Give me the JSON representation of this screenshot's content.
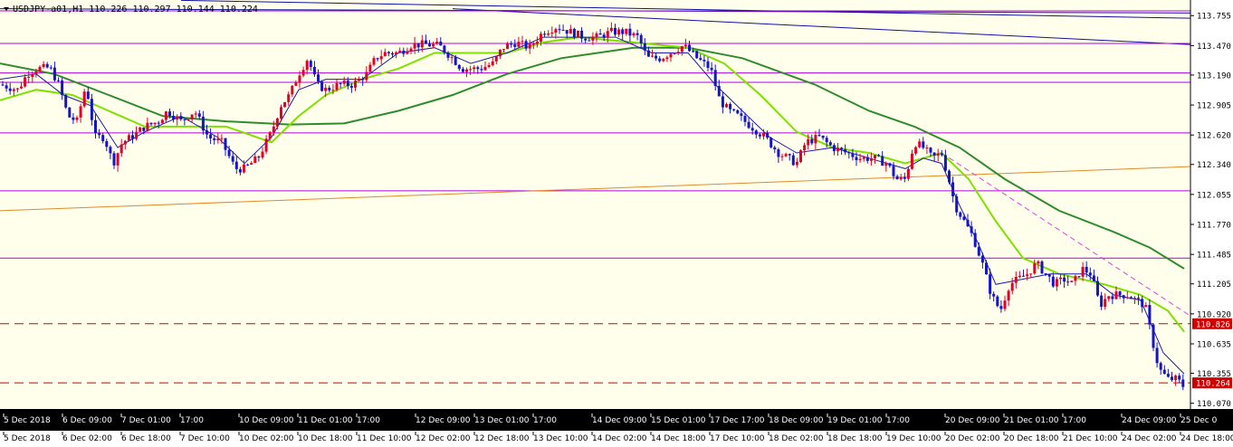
{
  "header": {
    "symbol_label": "USDJPY-a01,H1  110.226 110.297 110.144 110.224"
  },
  "colors": {
    "background": "#FFFFEB",
    "panel": "#FFFFFF",
    "axis_bar": "#000000",
    "bull_candle": "#E0002A",
    "bear_candle": "#1414C8",
    "ma_fast": "#1B1BA8",
    "ma_mid": "#7FE000",
    "ma_slow": "#2E8B2E",
    "level_line": "#B000E0",
    "trend_line": "#E08A2A",
    "channel_line": "#1010A0",
    "dashed_level": "#D00000",
    "diag_dash": "#E040E0",
    "tag_bg": "#D00000",
    "tag_text": "#FFFFFF"
  },
  "chart_data": {
    "type": "candlestick",
    "title": "USDJPY-a01,H1",
    "ohlc_latest": {
      "open": 110.226,
      "high": 110.297,
      "low": 110.144,
      "close": 110.224
    },
    "y_axis": {
      "range": [
        110.07,
        113.76
      ],
      "ticks": [
        "113.755",
        "113.470",
        "113.190",
        "112.905",
        "112.620",
        "112.340",
        "112.055",
        "111.770",
        "111.485",
        "111.205",
        "110.920",
        "110.635",
        "110.355",
        "110.070"
      ]
    },
    "x_axis_top": [
      "5 Dec 2018",
      "6 Dec 09:00",
      "7 Dec 01:00",
      "17:00",
      "10 Dec 09:00",
      "11 Dec 01:00",
      "17:00",
      "12 Dec 09:00",
      "13 Dec 01:00",
      "17:00",
      "14 Dec 09:00",
      "15 Dec 01:00",
      "17 Dec 17:00",
      "18 Dec 09:00",
      "19 Dec 01:00",
      "17:00",
      "20 Dec 09:00",
      "21 Dec 01:00",
      "17:00",
      "24 Dec 09:00",
      "25 Dec 0"
    ],
    "x_axis_bottom": [
      "5 Dec 2018",
      "6 Dec 02:00",
      "6 Dec 18:00",
      "7 Dec 10:00",
      "10 Dec 02:00",
      "10 Dec 18:00",
      "11 Dec 10:00",
      "12 Dec 02:00",
      "12 Dec 18:00",
      "13 Dec 10:00",
      "14 Dec 02:00",
      "14 Dec 18:00",
      "17 Dec 10:00",
      "18 Dec 02:00",
      "18 Dec 18:00",
      "19 Dec 10:00",
      "20 Dec 02:00",
      "20 Dec 18:00",
      "21 Dec 10:00",
      "24 Dec 02:00",
      "24 Dec 18:00"
    ],
    "price_tags": [
      {
        "label": "110.826",
        "value": 110.826
      },
      {
        "label": "110.264",
        "value": 110.264
      }
    ],
    "horizontal_levels": [
      113.8,
      113.49,
      113.21,
      113.12,
      112.64,
      112.09,
      111.45
    ],
    "dashed_levels": [
      110.826,
      110.264
    ],
    "close_path": [
      [
        0,
        113.1
      ],
      [
        20,
        113.05
      ],
      [
        30,
        113.2
      ],
      [
        40,
        113.25
      ],
      [
        55,
        113.26
      ],
      [
        65,
        113.1
      ],
      [
        75,
        112.8
      ],
      [
        85,
        112.75
      ],
      [
        95,
        113.1
      ],
      [
        105,
        112.6
      ],
      [
        115,
        112.6
      ],
      [
        125,
        112.35
      ],
      [
        135,
        112.55
      ],
      [
        145,
        112.6
      ],
      [
        160,
        112.7
      ],
      [
        175,
        112.75
      ],
      [
        185,
        112.85
      ],
      [
        200,
        112.75
      ],
      [
        215,
        112.85
      ],
      [
        230,
        112.6
      ],
      [
        245,
        112.55
      ],
      [
        260,
        112.3
      ],
      [
        270,
        112.3
      ],
      [
        285,
        112.4
      ],
      [
        300,
        112.65
      ],
      [
        310,
        112.9
      ],
      [
        320,
        113.0
      ],
      [
        330,
        113.2
      ],
      [
        340,
        113.35
      ],
      [
        350,
        113.1
      ],
      [
        360,
        113.05
      ],
      [
        375,
        113.1
      ],
      [
        390,
        113.1
      ],
      [
        405,
        113.2
      ],
      [
        415,
        113.35
      ],
      [
        425,
        113.4
      ],
      [
        440,
        113.4
      ],
      [
        455,
        113.48
      ],
      [
        470,
        113.48
      ],
      [
        485,
        113.47
      ],
      [
        500,
        113.35
      ],
      [
        510,
        113.25
      ],
      [
        520,
        113.25
      ],
      [
        530,
        113.25
      ],
      [
        545,
        113.3
      ],
      [
        555,
        113.45
      ],
      [
        570,
        113.5
      ],
      [
        585,
        113.45
      ],
      [
        600,
        113.6
      ],
      [
        615,
        113.65
      ],
      [
        630,
        113.6
      ],
      [
        645,
        113.55
      ],
      [
        660,
        113.55
      ],
      [
        675,
        113.6
      ],
      [
        690,
        113.6
      ],
      [
        705,
        113.55
      ],
      [
        715,
        113.35
      ],
      [
        730,
        113.35
      ],
      [
        740,
        113.4
      ],
      [
        755,
        113.47
      ],
      [
        770,
        113.35
      ],
      [
        785,
        113.25
      ],
      [
        795,
        112.95
      ],
      [
        805,
        112.85
      ],
      [
        815,
        112.8
      ],
      [
        830,
        112.7
      ],
      [
        845,
        112.6
      ],
      [
        860,
        112.45
      ],
      [
        870,
        112.4
      ],
      [
        880,
        112.35
      ],
      [
        890,
        112.55
      ],
      [
        905,
        112.6
      ],
      [
        920,
        112.5
      ],
      [
        935,
        112.45
      ],
      [
        950,
        112.4
      ],
      [
        965,
        112.4
      ],
      [
        980,
        112.35
      ],
      [
        990,
        112.2
      ],
      [
        1000,
        112.2
      ],
      [
        1010,
        112.55
      ],
      [
        1020,
        112.5
      ],
      [
        1030,
        112.4
      ],
      [
        1040,
        112.45
      ],
      [
        1048,
        112.2
      ],
      [
        1055,
        111.95
      ],
      [
        1065,
        111.8
      ],
      [
        1075,
        111.65
      ],
      [
        1085,
        111.4
      ],
      [
        1095,
        111.1
      ],
      [
        1105,
        110.95
      ],
      [
        1115,
        111.2
      ],
      [
        1125,
        111.25
      ],
      [
        1135,
        111.3
      ],
      [
        1145,
        111.4
      ],
      [
        1155,
        111.3
      ],
      [
        1165,
        111.2
      ],
      [
        1175,
        111.25
      ],
      [
        1185,
        111.2
      ],
      [
        1195,
        111.35
      ],
      [
        1205,
        111.3
      ],
      [
        1215,
        111.0
      ],
      [
        1225,
        111.1
      ],
      [
        1235,
        111.1
      ],
      [
        1245,
        111.1
      ],
      [
        1255,
        111.05
      ],
      [
        1265,
        111.0
      ],
      [
        1272,
        110.7
      ],
      [
        1280,
        110.4
      ],
      [
        1290,
        110.3
      ],
      [
        1300,
        110.3
      ],
      [
        1308,
        110.224
      ]
    ],
    "ma_fast_path": [
      [
        0,
        113.15
      ],
      [
        40,
        113.2
      ],
      [
        70,
        113.0
      ],
      [
        100,
        112.9
      ],
      [
        130,
        112.5
      ],
      [
        160,
        112.65
      ],
      [
        200,
        112.8
      ],
      [
        240,
        112.6
      ],
      [
        270,
        112.35
      ],
      [
        300,
        112.6
      ],
      [
        330,
        113.05
      ],
      [
        360,
        113.15
      ],
      [
        400,
        113.15
      ],
      [
        440,
        113.4
      ],
      [
        480,
        113.45
      ],
      [
        520,
        113.3
      ],
      [
        560,
        113.4
      ],
      [
        600,
        113.55
      ],
      [
        640,
        113.55
      ],
      [
        680,
        113.55
      ],
      [
        720,
        113.4
      ],
      [
        760,
        113.4
      ],
      [
        790,
        113.1
      ],
      [
        820,
        112.85
      ],
      [
        850,
        112.6
      ],
      [
        880,
        112.45
      ],
      [
        920,
        112.5
      ],
      [
        960,
        112.4
      ],
      [
        1000,
        112.3
      ],
      [
        1020,
        112.4
      ],
      [
        1040,
        112.35
      ],
      [
        1060,
        111.95
      ],
      [
        1080,
        111.6
      ],
      [
        1100,
        111.2
      ],
      [
        1130,
        111.25
      ],
      [
        1160,
        111.3
      ],
      [
        1200,
        111.3
      ],
      [
        1230,
        111.1
      ],
      [
        1260,
        111.05
      ],
      [
        1285,
        110.55
      ],
      [
        1308,
        110.35
      ]
    ],
    "ma_mid_path": [
      [
        0,
        112.95
      ],
      [
        40,
        113.05
      ],
      [
        80,
        113.0
      ],
      [
        120,
        112.85
      ],
      [
        160,
        112.7
      ],
      [
        200,
        112.7
      ],
      [
        250,
        112.7
      ],
      [
        300,
        112.55
      ],
      [
        330,
        112.8
      ],
      [
        360,
        113.0
      ],
      [
        400,
        113.15
      ],
      [
        440,
        113.25
      ],
      [
        480,
        113.4
      ],
      [
        520,
        113.4
      ],
      [
        560,
        113.4
      ],
      [
        600,
        113.5
      ],
      [
        640,
        113.55
      ],
      [
        700,
        113.5
      ],
      [
        760,
        113.45
      ],
      [
        800,
        113.3
      ],
      [
        840,
        113.0
      ],
      [
        880,
        112.65
      ],
      [
        920,
        112.5
      ],
      [
        960,
        112.45
      ],
      [
        1000,
        112.35
      ],
      [
        1040,
        112.45
      ],
      [
        1070,
        112.2
      ],
      [
        1100,
        111.8
      ],
      [
        1130,
        111.45
      ],
      [
        1170,
        111.3
      ],
      [
        1220,
        111.2
      ],
      [
        1260,
        111.1
      ],
      [
        1290,
        110.95
      ],
      [
        1308,
        110.75
      ]
    ],
    "ma_slow_path": [
      [
        0,
        113.3
      ],
      [
        60,
        113.2
      ],
      [
        120,
        113.0
      ],
      [
        180,
        112.8
      ],
      [
        250,
        112.75
      ],
      [
        320,
        112.72
      ],
      [
        380,
        112.73
      ],
      [
        440,
        112.85
      ],
      [
        500,
        113.0
      ],
      [
        560,
        113.2
      ],
      [
        620,
        113.35
      ],
      [
        700,
        113.45
      ],
      [
        760,
        113.45
      ],
      [
        820,
        113.35
      ],
      [
        900,
        113.1
      ],
      [
        960,
        112.85
      ],
      [
        1010,
        112.7
      ],
      [
        1060,
        112.5
      ],
      [
        1110,
        112.2
      ],
      [
        1170,
        111.9
      ],
      [
        1230,
        111.7
      ],
      [
        1270,
        111.55
      ],
      [
        1308,
        111.35
      ]
    ],
    "trend_line": {
      "from": [
        0,
        111.9
      ],
      "to": [
        1315,
        112.32
      ]
    },
    "channel_lines": [
      {
        "from": [
          0,
          113.82
        ],
        "to": [
          1315,
          113.78
        ]
      },
      {
        "from": [
          200,
          113.9
        ],
        "to": [
          1315,
          113.73
        ]
      },
      {
        "from": [
          500,
          113.82
        ],
        "to": [
          1315,
          113.48
        ]
      }
    ],
    "diag_dash": {
      "from": [
        1040,
        112.45
      ],
      "to": [
        1315,
        110.9
      ]
    },
    "grid": false,
    "legend": "none"
  }
}
